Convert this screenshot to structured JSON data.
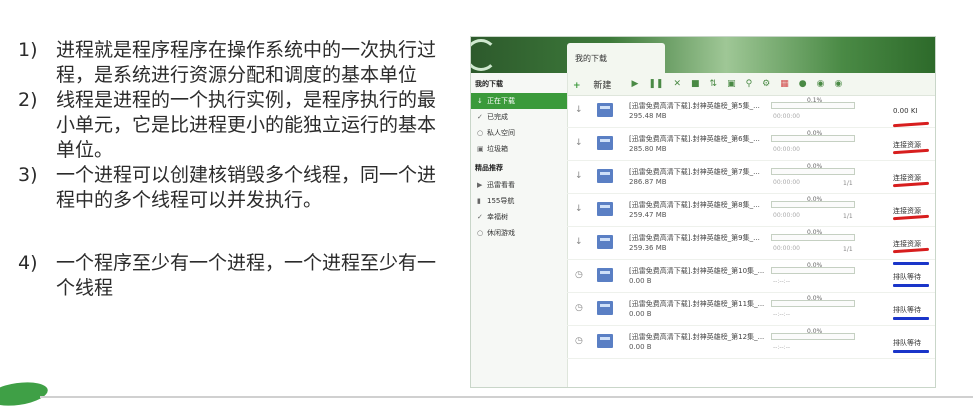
{
  "slide": {
    "points": [
      {
        "num": "1)",
        "text": "进程就是程序程序在操作系统中的一次执行过程，是系统进行资源分配和调度的基本单位"
      },
      {
        "num": "2)",
        "text": "线程是进程的一个执行实例，是程序执行的最小单元，它是比进程更小的能独立运行的基本单位。"
      },
      {
        "num": "3)",
        "text": "一个进程可以创建核销毁多个线程，同一个进程中的多个线程可以并发执行。"
      },
      {
        "num": "4)",
        "text": "一个程序至少有一个进程，一个进程至少有一个线程"
      }
    ]
  },
  "app": {
    "tab_title": "我的下载",
    "toolbar": {
      "new_label": "新建",
      "icons": [
        "play-icon",
        "pause-icon",
        "delete-icon",
        "folder-icon",
        "sort-icon",
        "view-icon",
        "search-icon",
        "settings-icon",
        "gift-icon",
        "shield-icon",
        "speed-icon",
        "more-icon"
      ]
    },
    "sidebar": {
      "section1": "我的下载",
      "items": [
        {
          "icon": "download-icon",
          "label": "正在下载",
          "active": true
        },
        {
          "icon": "check-icon",
          "label": "已完成",
          "active": false
        },
        {
          "icon": "lock-icon",
          "label": "私人空间",
          "active": false
        },
        {
          "icon": "trash-icon",
          "label": "垃圾箱",
          "active": false
        }
      ],
      "section2": "精品推荐",
      "items2": [
        {
          "icon": "play-icon",
          "label": "迅雷看看"
        },
        {
          "icon": "nav-icon",
          "label": "155导航"
        },
        {
          "icon": "tree-icon",
          "label": "幸福树"
        },
        {
          "icon": "game-icon",
          "label": "休闲游戏"
        }
      ]
    },
    "first_row_speed": "0.00",
    "first_row_speed_unit": "KI",
    "downloads": [
      {
        "name": "[迅雷免费高清下载].封神英雄榜_第5集_...",
        "size": "295.48 MB",
        "progress": "0.1%",
        "time": "00:00:00",
        "conn": "",
        "status": ""
      },
      {
        "name": "[迅雷免费高清下载].封神英雄榜_第6集_...",
        "size": "285.80 MB",
        "progress": "0.0%",
        "time": "00:00:00",
        "conn": "",
        "status": "连接资源"
      },
      {
        "name": "[迅雷免费高清下载].封神英雄榜_第7集_...",
        "size": "286.87 MB",
        "progress": "0.0%",
        "time": "00:00:00",
        "conn": "1/1",
        "status": "连接资源"
      },
      {
        "name": "[迅雷免费高清下载].封神英雄榜_第8集_...",
        "size": "259.47 MB",
        "progress": "0.0%",
        "time": "00:00:00",
        "conn": "1/1",
        "status": "连接资源"
      },
      {
        "name": "[迅雷免费高清下载].封神英雄榜_第9集_...",
        "size": "259.36 MB",
        "progress": "0.0%",
        "time": "00:00:00",
        "conn": "1/1",
        "status": "连接资源"
      },
      {
        "name": "[迅雷免费高清下载].封神英雄榜_第10集_...",
        "size": "0.00 B",
        "progress": "0.0%",
        "time": "--:--:--",
        "conn": "",
        "status": "排队等待"
      },
      {
        "name": "[迅雷免费高清下载].封神英雄榜_第11集_...",
        "size": "0.00 B",
        "progress": "0.0%",
        "time": "--:--:--",
        "conn": "",
        "status": "排队等待"
      },
      {
        "name": "[迅雷免费高清下载].封神英雄榜_第12集_...",
        "size": "0.00 B",
        "progress": "0.0%",
        "time": "--:--:--",
        "conn": "",
        "status": "排队等待"
      }
    ],
    "colors": {
      "accent": "#3b9a3b",
      "annotation_red": "#d71e1e",
      "annotation_blue": "#1a35c9"
    }
  }
}
